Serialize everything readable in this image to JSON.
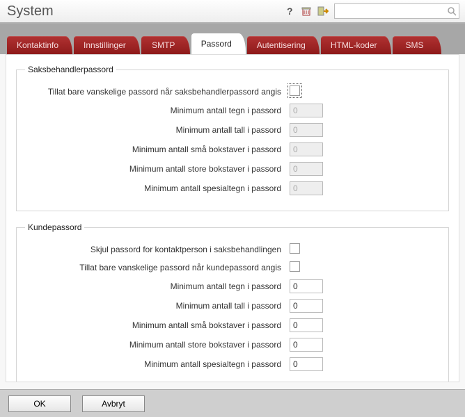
{
  "window": {
    "title": "System"
  },
  "search": {
    "placeholder": ""
  },
  "tabs": [
    {
      "label": "Kontaktinfo",
      "active": false
    },
    {
      "label": "Innstillinger",
      "active": false
    },
    {
      "label": "SMTP",
      "active": false
    },
    {
      "label": "Passord",
      "active": true
    },
    {
      "label": "Autentisering",
      "active": false
    },
    {
      "label": "HTML-koder",
      "active": false
    },
    {
      "label": "SMS",
      "active": false
    }
  ],
  "groups": {
    "adminpw": {
      "legend": "Saksbehandlerpassord",
      "rows": [
        {
          "label": "Tillat bare vanskelige passord når saksbehandlerpassord angis",
          "type": "checkbox",
          "checked": false,
          "focused": true
        },
        {
          "label": "Minimum antall tegn i passord",
          "type": "number",
          "value": "0",
          "enabled": false
        },
        {
          "label": "Minimum antall tall i passord",
          "type": "number",
          "value": "0",
          "enabled": false
        },
        {
          "label": "Minimum antall små bokstaver i passord",
          "type": "number",
          "value": "0",
          "enabled": false
        },
        {
          "label": "Minimum antall store bokstaver i passord",
          "type": "number",
          "value": "0",
          "enabled": false
        },
        {
          "label": "Minimum antall spesialtegn i passord",
          "type": "number",
          "value": "0",
          "enabled": false
        }
      ]
    },
    "custpw": {
      "legend": "Kundepassord",
      "rows": [
        {
          "label": "Skjul passord for kontaktperson i saksbehandlingen",
          "type": "checkbox",
          "checked": false
        },
        {
          "label": "Tillat bare vanskelige passord når kundepassord angis",
          "type": "checkbox",
          "checked": false
        },
        {
          "label": "Minimum antall tegn i passord",
          "type": "number",
          "value": "0",
          "enabled": true
        },
        {
          "label": "Minimum antall tall i passord",
          "type": "number",
          "value": "0",
          "enabled": true
        },
        {
          "label": "Minimum antall små bokstaver i passord",
          "type": "number",
          "value": "0",
          "enabled": true
        },
        {
          "label": "Minimum antall store bokstaver i passord",
          "type": "number",
          "value": "0",
          "enabled": true
        },
        {
          "label": "Minimum antall spesialtegn i passord",
          "type": "number",
          "value": "0",
          "enabled": true
        }
      ]
    }
  },
  "buttons": {
    "ok": "OK",
    "cancel": "Avbryt"
  },
  "icons": {
    "help": "?",
    "save": "save",
    "exit": "exit",
    "search": "search"
  }
}
